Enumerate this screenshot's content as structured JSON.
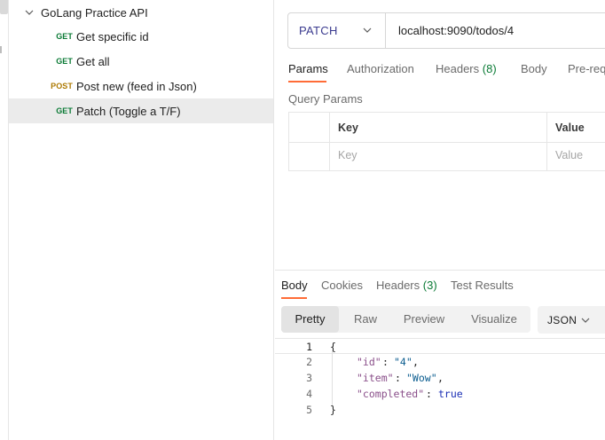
{
  "sidebar": {
    "folder": "GoLang Practice API",
    "requests": [
      {
        "method": "GET",
        "name": "Get specific id"
      },
      {
        "method": "GET",
        "name": "Get all"
      },
      {
        "method": "POST",
        "name": "Post new (feed in Json)"
      },
      {
        "method": "GET",
        "name": "Patch (Toggle a T/F)",
        "active": true
      }
    ]
  },
  "request": {
    "method": "PATCH",
    "url": "localhost:9090/todos/4",
    "tabs": [
      "Params",
      "Authorization",
      "Headers",
      "Body",
      "Pre-req"
    ],
    "headers_count": "(8)",
    "active_tab": "Params",
    "query_params_title": "Query Params",
    "table": {
      "columns": [
        "Key",
        "Value"
      ],
      "placeholders": [
        "Key",
        "Value"
      ]
    }
  },
  "response": {
    "tabs": [
      "Body",
      "Cookies",
      "Headers",
      "Test Results"
    ],
    "headers_count": "(3)",
    "active_tab": "Body",
    "views": [
      "Pretty",
      "Raw",
      "Preview",
      "Visualize"
    ],
    "active_view": "Pretty",
    "format": "JSON",
    "code": {
      "line_numbers": [
        "1",
        "2",
        "3",
        "4",
        "5"
      ],
      "open_brace": "{",
      "close_brace": "}",
      "fields": [
        {
          "key": "\"id\"",
          "value": "\"4\"",
          "type": "string",
          "comma": ","
        },
        {
          "key": "\"item\"",
          "value": "\"Wow\"",
          "type": "string",
          "comma": ","
        },
        {
          "key": "\"completed\"",
          "value": "true",
          "type": "bool",
          "comma": ""
        }
      ],
      "colon": ":"
    }
  },
  "colors": {
    "accent": "#ff6c37",
    "get": "#0a7a35",
    "post": "#ad7a03"
  }
}
